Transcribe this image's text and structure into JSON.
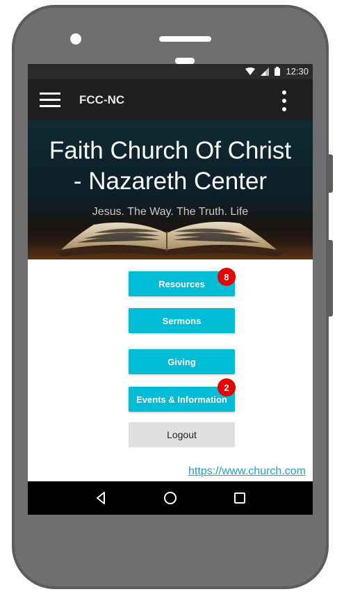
{
  "status_bar": {
    "time": "12:30",
    "icons": [
      "wifi-icon",
      "signal-icon",
      "battery-icon"
    ]
  },
  "app_bar": {
    "title": "FCC-NC",
    "menu_icon": "hamburger-menu-icon",
    "overflow_icon": "overflow-menu-icon"
  },
  "hero": {
    "title_line1": "Faith Church Of Christ",
    "title_line2": "- Nazareth Center",
    "subtitle": "Jesus. The Way. The Truth. Life"
  },
  "menu": {
    "resources": {
      "label": "Resources",
      "badge": "8"
    },
    "sermons": {
      "label": "Sermons"
    },
    "giving": {
      "label": "Giving"
    },
    "events": {
      "label": "Events & Information",
      "badge": "2"
    },
    "logout": {
      "label": "Logout"
    }
  },
  "footer_link": "https://www.church.com",
  "nav_bar": {
    "icons": [
      "back-icon",
      "home-icon",
      "recents-icon"
    ]
  },
  "colors": {
    "accent": "#00bcd4",
    "badge": "#e80000",
    "app_bar": "#1e1e1e",
    "link": "#1aa3c9"
  }
}
